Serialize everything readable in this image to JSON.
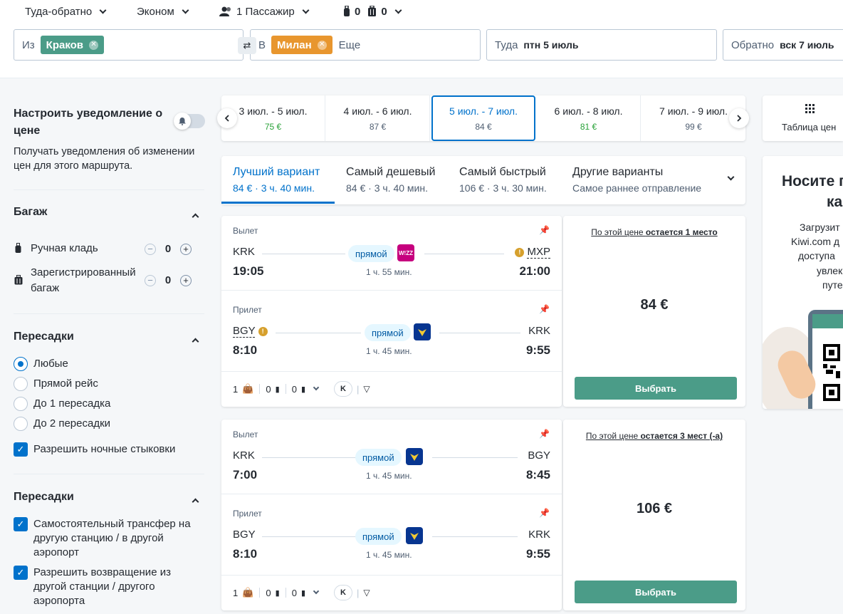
{
  "search": {
    "trip_type": "Туда-обратно",
    "cabin": "Эконом",
    "passengers": "1 Пассажир",
    "cabin_bags": "0",
    "checked_bags": "0",
    "from_label": "Из",
    "from_chip": "Краков",
    "to_label": "В",
    "to_chip": "Милан",
    "to_more": "Еще",
    "depart_label": "Туда",
    "depart_value": "птн 5 июль",
    "return_label": "Обратно",
    "return_value": "вск 7 июль"
  },
  "sidebar": {
    "alert_title": "Настроить уведомление о цене",
    "alert_desc": "Получать уведомления об изменении цен для этого маршрута.",
    "baggage_title": "Багаж",
    "cabin_bag_label": "Ручная кладь",
    "cabin_bag_value": "0",
    "checked_bag_label": "Зарегистрированный багаж",
    "checked_bag_value": "0",
    "stops_title": "Пересадки",
    "stops_options": [
      "Любые",
      "Прямой рейс",
      "До 1 пересадка",
      "До 2 пересадки"
    ],
    "overnight_label": "Разрешить ночные стыковки",
    "transfers_title": "Пересадки",
    "transfer_opt1": "Самостоятельный трансфер на другую станцию / в другой аэропорт",
    "transfer_opt2": "Разрешить возвращение из другой станции / другого аэропорта"
  },
  "date_strip": [
    {
      "dates": "3 июл. - 5 июл.",
      "price": "75 €",
      "cheap": true
    },
    {
      "dates": "4 июл. - 6 июл.",
      "price": "87 €",
      "cheap": false
    },
    {
      "dates": "5 июл. - 7 июл.",
      "price": "84 €",
      "cheap": false
    },
    {
      "dates": "6 июл. - 8 июл.",
      "price": "81 €",
      "cheap": true
    },
    {
      "dates": "7 июл. - 9 июл.",
      "price": "99 €",
      "cheap": false
    }
  ],
  "price_table_label": "Таблица цен",
  "sort_tabs": [
    {
      "title": "Лучший вариант",
      "sub": "84 € · 3 ч. 40 мин."
    },
    {
      "title": "Самый дешевый",
      "sub": "84 € · 3 ч. 40 мин."
    },
    {
      "title": "Самый быстрый",
      "sub": "106 € · 3 ч. 30 мин."
    },
    {
      "title": "Другие варианты",
      "sub": "Самое раннее отправление"
    }
  ],
  "results": [
    {
      "outbound": {
        "label": "Вылет",
        "from": "KRK",
        "to": "MXP",
        "dep": "19:05",
        "arr": "21:00",
        "duration": "1 ч. 55 мин.",
        "direct": "прямой",
        "airline_icon": "W!ZZ"
      },
      "inbound": {
        "label": "Прилет",
        "from": "BGY",
        "to": "KRK",
        "dep": "8:10",
        "arr": "9:55",
        "duration": "1 ч. 45 мин.",
        "direct": "прямой"
      },
      "bags": {
        "personal": "1",
        "cabin": "0",
        "checked": "0"
      },
      "seats_prefix": "По этой цене ",
      "seats_bold": "остается 1 место",
      "price": "84 €",
      "select": "Выбрать"
    },
    {
      "outbound": {
        "label": "Вылет",
        "from": "KRK",
        "to": "BGY",
        "dep": "7:00",
        "arr": "8:45",
        "duration": "1 ч. 45 мин.",
        "direct": "прямой"
      },
      "inbound": {
        "label": "Прилет",
        "from": "BGY",
        "to": "KRK",
        "dep": "8:10",
        "arr": "9:55",
        "duration": "1 ч. 45 мин.",
        "direct": "прямой"
      },
      "bags": {
        "personal": "1",
        "cabin": "0",
        "checked": "0"
      },
      "seats_prefix": "По этой цене ",
      "seats_bold": "остается 3 мест (-а)",
      "price": "106 €",
      "select": "Выбрать"
    }
  ],
  "promo": {
    "title1": "Носите п",
    "title2": "ка",
    "line1": "Загрузит",
    "line2": "Kiwi.com д",
    "line3": "доступа",
    "line4": "увлек",
    "line5": "путе"
  },
  "colors": {
    "from_chip": "#4b9c88",
    "to_chip": "#e8962e",
    "accent": "#0172cb",
    "select_btn": "#4b9c88"
  }
}
